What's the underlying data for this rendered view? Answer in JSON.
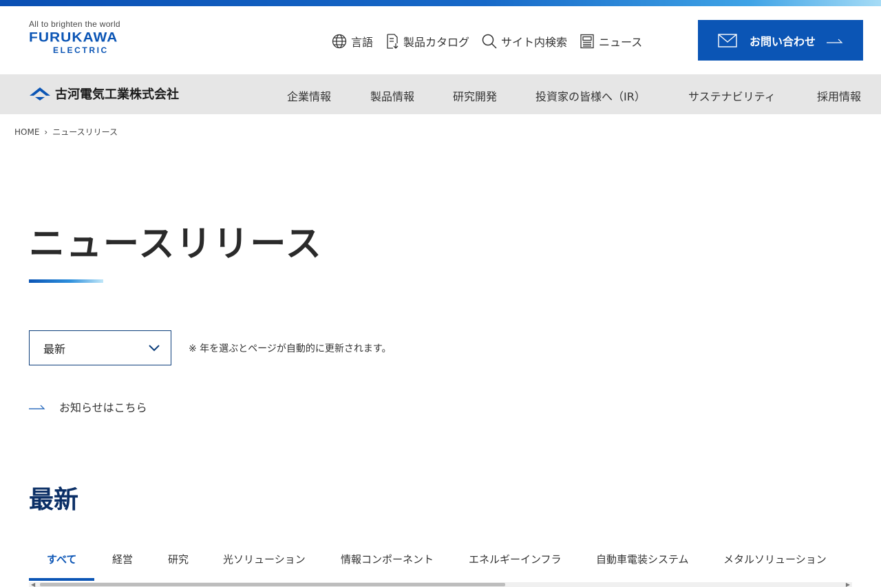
{
  "colors": {
    "brand": "#0b55b5",
    "nav_bg": "#e6e6e6",
    "section_title": "#0b2f66"
  },
  "header": {
    "tagline": "All to brighten the world",
    "brand": "FURUKAWA",
    "brand_sub": "ELECTRIC",
    "utility_nav": [
      {
        "label": "言語",
        "icon": "globe-icon"
      },
      {
        "label": "製品カタログ",
        "icon": "catalog-icon"
      },
      {
        "label": "サイト内検索",
        "icon": "search-icon"
      },
      {
        "label": "ニュース",
        "icon": "news-icon"
      }
    ],
    "contact_label": "お問い合わせ"
  },
  "main_nav": {
    "company_name": "古河電気工業株式会社",
    "items": [
      "企業情報",
      "製品情報",
      "研究開発",
      "投資家の皆様へ（IR）",
      "サステナビリティ",
      "採用情報"
    ]
  },
  "breadcrumb": {
    "home": "HOME",
    "current": "ニュースリリース"
  },
  "page": {
    "title": "ニュースリリース",
    "year_select_value": "最新",
    "select_note": "※ 年を選ぶとページが自動的に更新されます。",
    "notice_link": "お知らせはこちら",
    "section_title": "最新"
  },
  "tabs": [
    "すべて",
    "経営",
    "研究",
    "光ソリューション",
    "情報コンポーネント",
    "エネルギーインフラ",
    "自動車電装システム",
    "メタルソリューション"
  ],
  "active_tab": "すべて"
}
